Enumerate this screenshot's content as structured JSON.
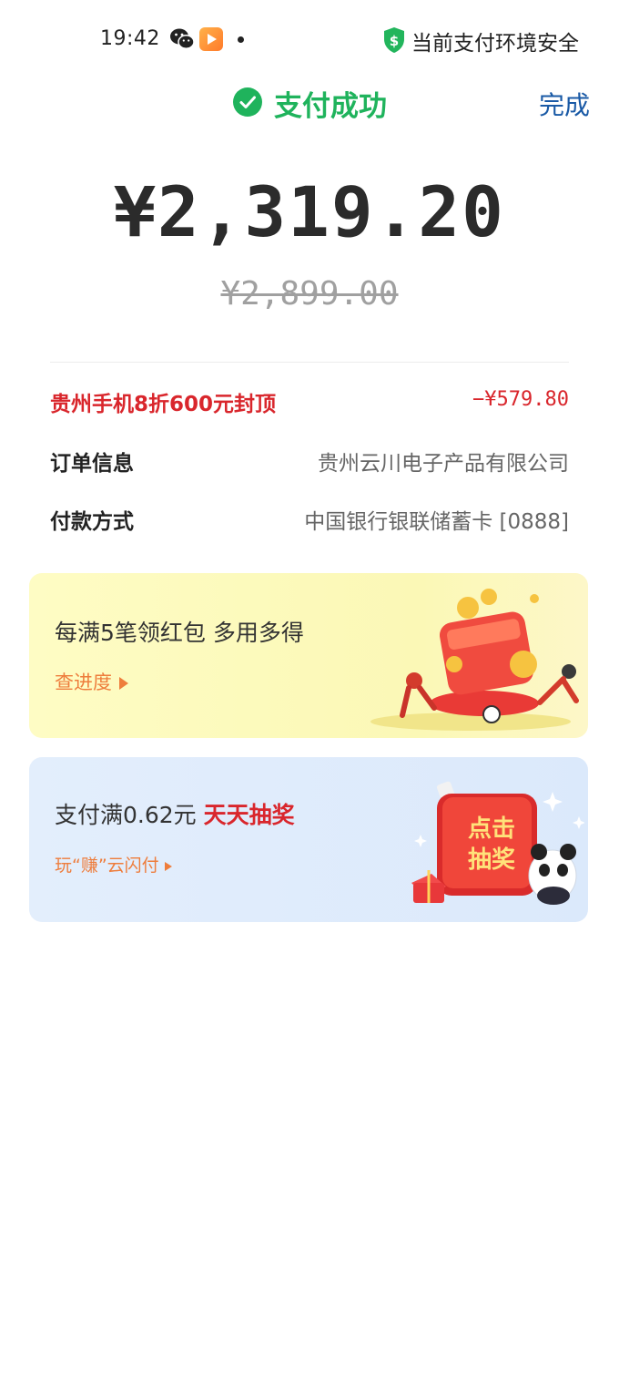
{
  "status_bar": {
    "time": "19:42",
    "icons": [
      "wechat-icon",
      "video-app-icon",
      "dot-icon",
      "shield-dollar-icon"
    ],
    "secure_text": "当前支付环境安全"
  },
  "header": {
    "title": "支付成功",
    "done_label": "完成",
    "accent_color": "#1fb35c"
  },
  "payment": {
    "amount": "¥2,319.20",
    "original_amount": "¥2,899.00"
  },
  "details": [
    {
      "label": "贵州手机8折600元封顶",
      "value": "−¥579.80",
      "color": "#d9262c"
    },
    {
      "label": "订单信息",
      "value": "贵州云川电子产品有限公司"
    },
    {
      "label": "付款方式",
      "value": "中国银行银联储蓄卡 [0888]"
    }
  ],
  "banners": {
    "redpacket": {
      "title": "每满5笔领红包 多用多得",
      "link": "查进度"
    },
    "lottery": {
      "title_prefix": "支付满0.62元 ",
      "title_highlight": "天天抽奖",
      "link": "玩“赚”云闪付",
      "button_line1": "点击",
      "button_line2": "抽奖"
    }
  }
}
